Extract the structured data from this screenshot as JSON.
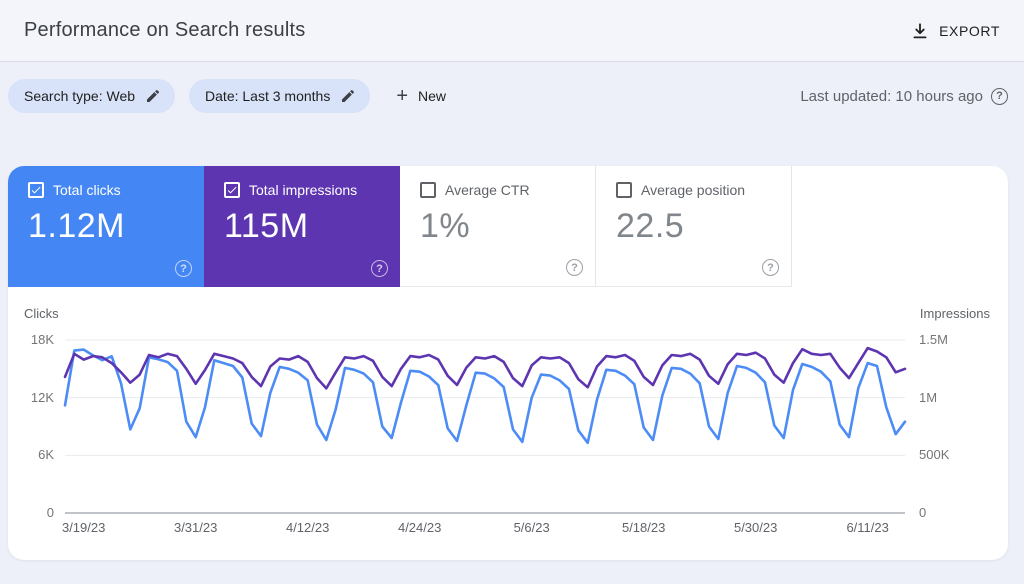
{
  "header": {
    "title": "Performance on Search results",
    "export_label": "EXPORT"
  },
  "filters": {
    "search_type_chip": "Search type: Web",
    "date_chip": "Date: Last 3 months",
    "new_label": "New",
    "last_updated": "Last updated: 10 hours ago",
    "help_glyph": "?"
  },
  "metrics": [
    {
      "label": "Total clicks",
      "value": "1.12M",
      "checked": true,
      "bg": "#4487f4",
      "text_color": "#ffffff"
    },
    {
      "label": "Total impressions",
      "value": "115M",
      "checked": true,
      "bg": "#5e35b1",
      "text_color": "#ffffff"
    },
    {
      "label": "Average CTR",
      "value": "1%",
      "checked": false,
      "bg": "#ffffff"
    },
    {
      "label": "Average position",
      "value": "22.5",
      "checked": false,
      "bg": "#ffffff"
    }
  ],
  "chart_data": {
    "type": "line",
    "left_axis": {
      "title": "Clicks",
      "range": [
        0,
        18000
      ],
      "ticks": [
        {
          "label": "18K",
          "value": 18000
        },
        {
          "label": "12K",
          "value": 12000
        },
        {
          "label": "6K",
          "value": 6000
        },
        {
          "label": "0",
          "value": 0
        }
      ]
    },
    "right_axis": {
      "title": "Impressions",
      "range": [
        0,
        1500000
      ],
      "ticks": [
        {
          "label": "1.5M",
          "value": 1500000
        },
        {
          "label": "1M",
          "value": 1000000
        },
        {
          "label": "500K",
          "value": 500000
        },
        {
          "label": "0",
          "value": 0
        }
      ]
    },
    "x_ticks": [
      {
        "label": "3/19/23",
        "day": 2
      },
      {
        "label": "3/31/23",
        "day": 14
      },
      {
        "label": "4/12/23",
        "day": 26
      },
      {
        "label": "4/24/23",
        "day": 38
      },
      {
        "label": "5/6/23",
        "day": 50
      },
      {
        "label": "5/18/23",
        "day": 62
      },
      {
        "label": "5/30/23",
        "day": 74
      },
      {
        "label": "6/11/23",
        "day": 86
      }
    ],
    "num_days": 91,
    "grid": true,
    "series": [
      {
        "name": "Clicks",
        "axis": "left",
        "color": "#4d8cf5",
        "values": [
          11200,
          16900,
          17000,
          16400,
          15900,
          16300,
          13500,
          8700,
          10900,
          16200,
          16000,
          15700,
          14800,
          9500,
          7900,
          11000,
          15900,
          15600,
          15300,
          14100,
          9300,
          8000,
          12500,
          15200,
          15000,
          14600,
          13800,
          9200,
          7600,
          10800,
          15100,
          14900,
          14500,
          13600,
          9000,
          7800,
          11500,
          14800,
          14700,
          14200,
          13300,
          8800,
          7500,
          11200,
          14600,
          14500,
          14000,
          13100,
          8700,
          7400,
          12000,
          14400,
          14300,
          13800,
          12900,
          8600,
          7300,
          11800,
          14900,
          14800,
          14300,
          13400,
          8900,
          7600,
          12200,
          15100,
          15000,
          14500,
          13500,
          9000,
          7700,
          12500,
          15300,
          15100,
          14600,
          13600,
          9100,
          7800,
          12800,
          15500,
          15200,
          14700,
          13700,
          9200,
          7900,
          13000,
          15600,
          15300,
          11000,
          8200,
          9500
        ]
      },
      {
        "name": "Impressions",
        "axis": "right",
        "color": "#5e35b1",
        "values": [
          1180000,
          1380000,
          1330000,
          1360000,
          1350000,
          1300000,
          1220000,
          1130000,
          1200000,
          1370000,
          1350000,
          1380000,
          1360000,
          1250000,
          1120000,
          1240000,
          1380000,
          1360000,
          1340000,
          1300000,
          1180000,
          1100000,
          1270000,
          1340000,
          1330000,
          1360000,
          1310000,
          1170000,
          1080000,
          1220000,
          1350000,
          1340000,
          1360000,
          1320000,
          1180000,
          1100000,
          1250000,
          1360000,
          1350000,
          1370000,
          1330000,
          1190000,
          1110000,
          1260000,
          1350000,
          1340000,
          1360000,
          1310000,
          1170000,
          1100000,
          1280000,
          1350000,
          1340000,
          1350000,
          1300000,
          1160000,
          1090000,
          1270000,
          1360000,
          1350000,
          1370000,
          1320000,
          1180000,
          1110000,
          1280000,
          1370000,
          1360000,
          1380000,
          1330000,
          1190000,
          1120000,
          1290000,
          1380000,
          1370000,
          1390000,
          1340000,
          1200000,
          1130000,
          1300000,
          1420000,
          1380000,
          1370000,
          1380000,
          1260000,
          1170000,
          1300000,
          1430000,
          1400000,
          1350000,
          1220000,
          1250000
        ]
      }
    ]
  },
  "colors": {
    "page_bg": "#edf0f8",
    "header_bg": "#f3f5fb",
    "panel_bg": "#ffffff",
    "chip_bg": "#d8e2f8",
    "grid_line": "#e9ebee",
    "baseline": "#9aa0a6",
    "clicks_card": "#4487f4",
    "impressions_card": "#5e35b1"
  }
}
